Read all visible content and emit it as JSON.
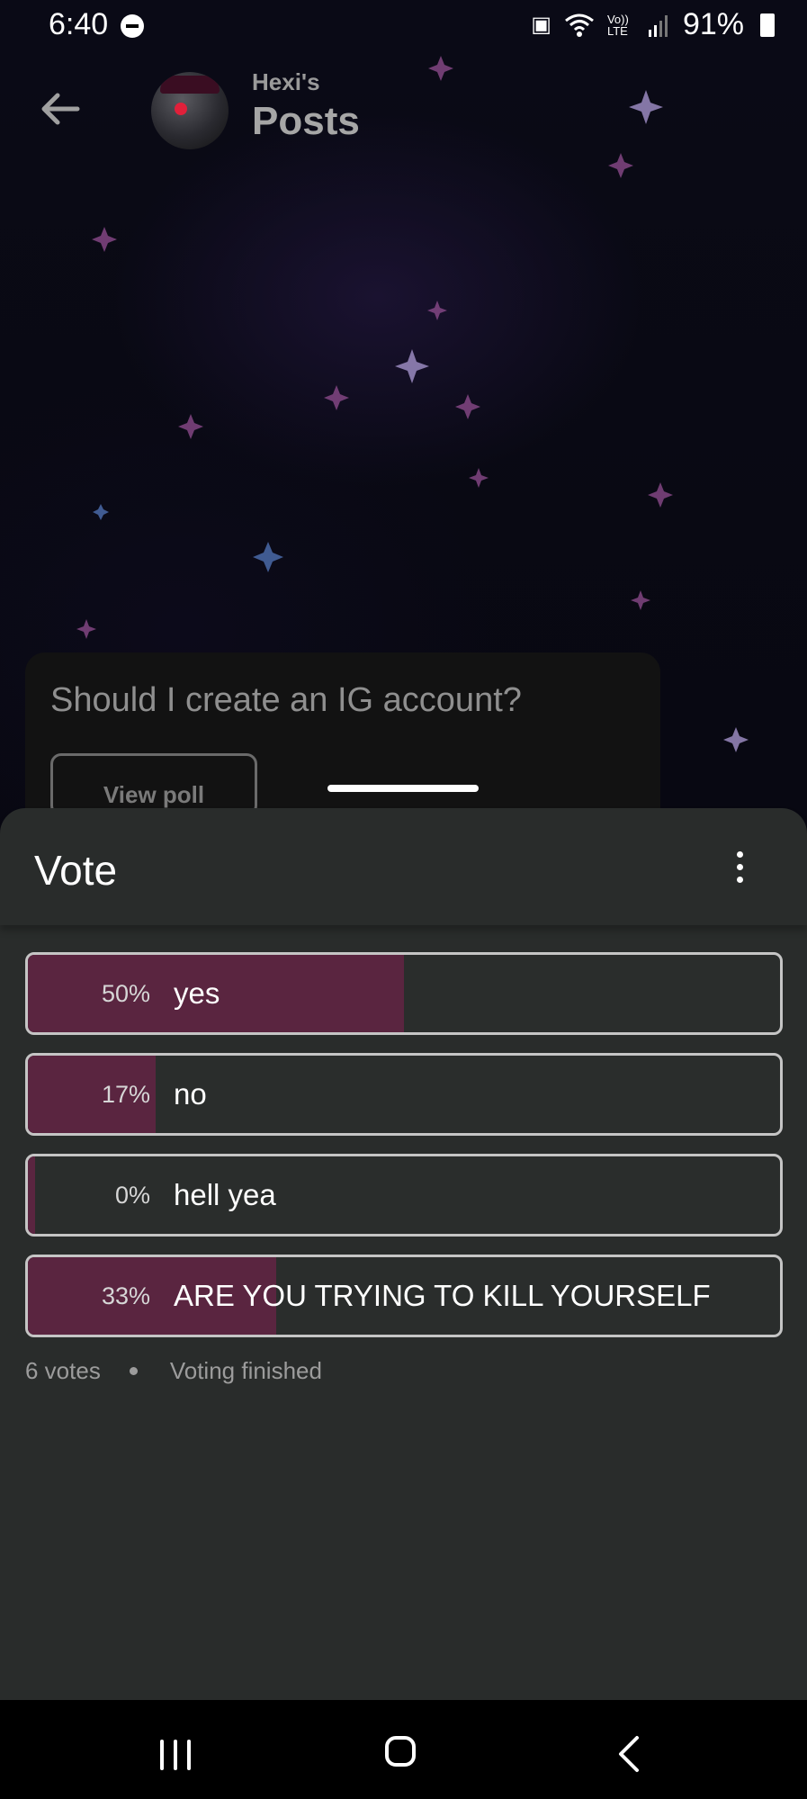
{
  "status_bar": {
    "time": "6:40",
    "battery": "91%",
    "icons": [
      "do-not-disturb-icon",
      "nfc-icon",
      "wifi-icon",
      "volte-icon",
      "signal-icon",
      "battery-icon"
    ],
    "volte_label": "Vo)) LTE"
  },
  "header": {
    "subtitle": "Hexi's",
    "title": "Posts"
  },
  "poll_card": {
    "question": "Should I create an IG account?",
    "view_poll_label": "View poll"
  },
  "sheet": {
    "title": "Vote",
    "options": [
      {
        "percent_label": "50%",
        "label": "yes",
        "percent": 50
      },
      {
        "percent_label": "17%",
        "label": "no",
        "percent": 17
      },
      {
        "percent_label": "0%",
        "label": "hell yea",
        "percent": 0
      },
      {
        "percent_label": "33%",
        "label": "ARE YOU TRYING TO KILL YOURSELF",
        "percent": 33
      }
    ],
    "votes": "6 votes",
    "status": "Voting finished"
  },
  "colors": {
    "result_fill": "#5a2540",
    "sheet_bg": "#292c2b",
    "option_border": "#c5c5c5"
  }
}
